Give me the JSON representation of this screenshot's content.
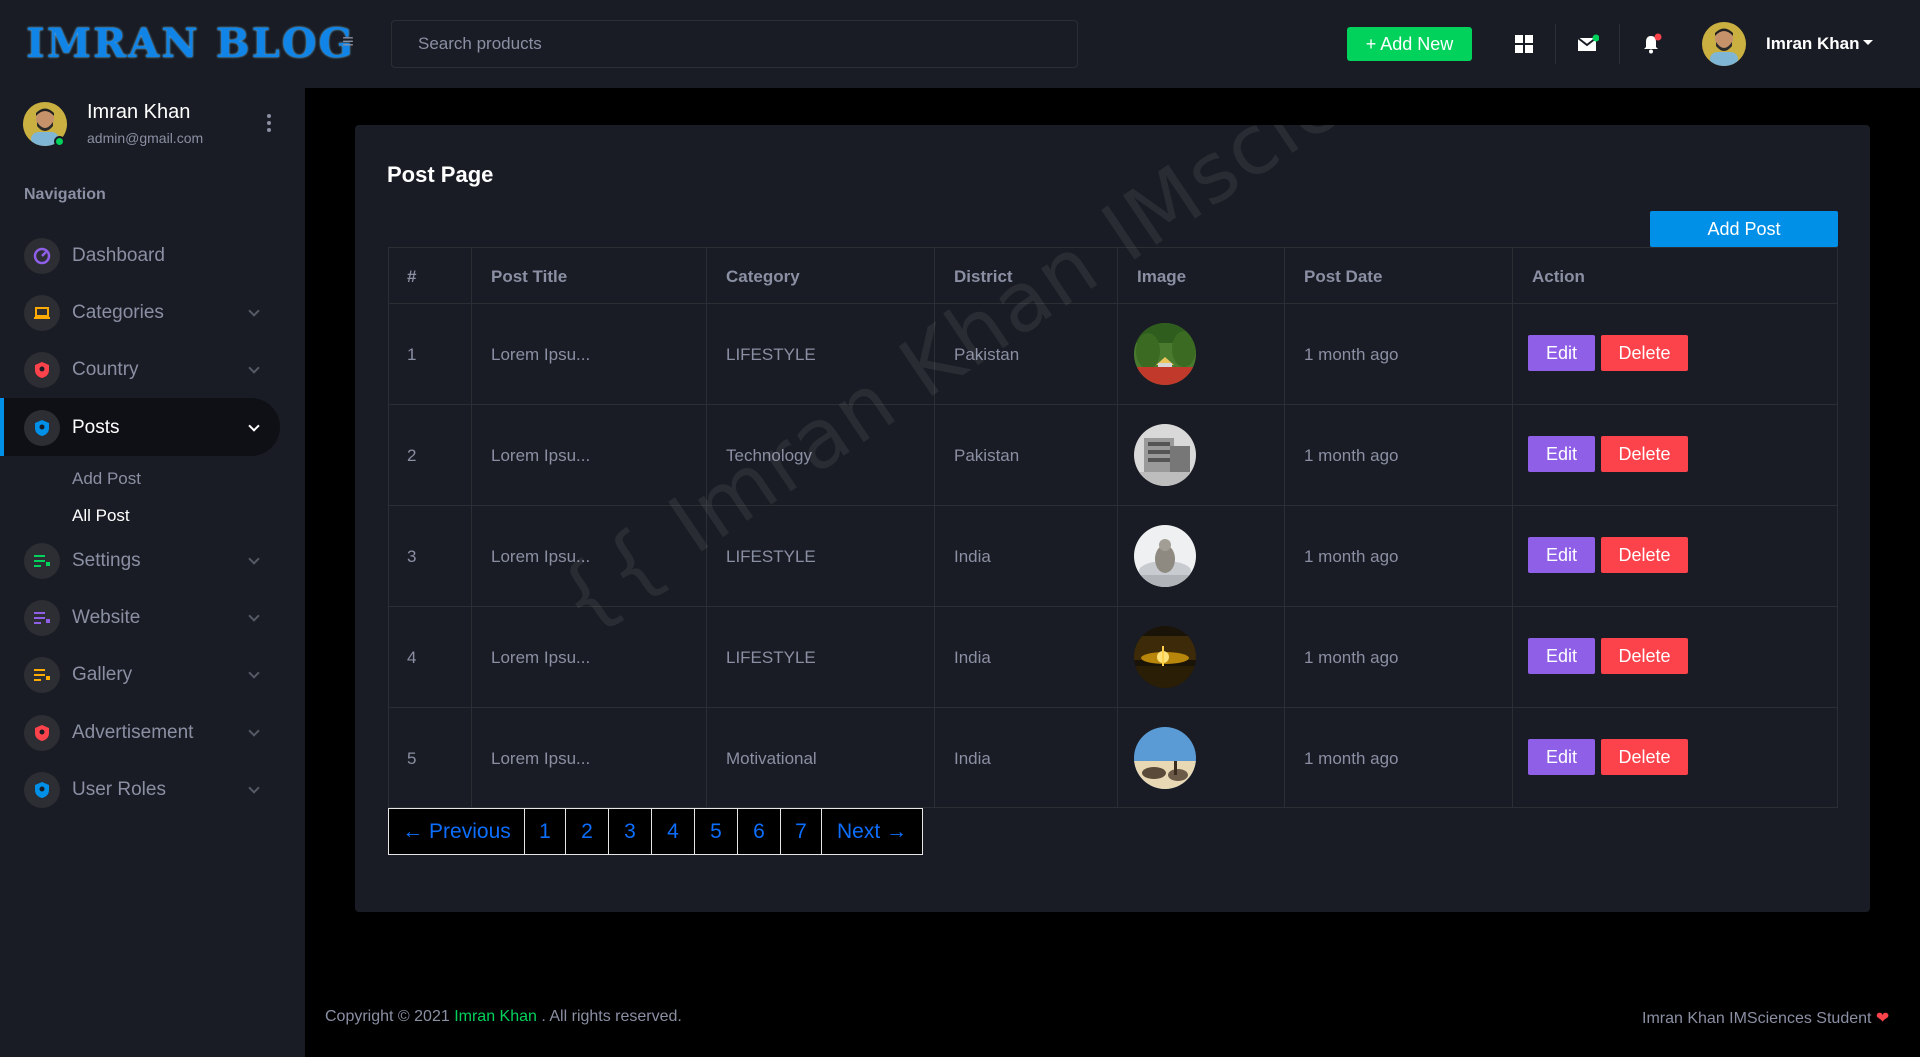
{
  "brand": "IMRAN BLOG",
  "search": {
    "placeholder": "Search products"
  },
  "header": {
    "add_new_label": "+ Add New",
    "user_name": "Imran Khan"
  },
  "sidebar": {
    "profile": {
      "name": "Imran Khan",
      "email": "admin@gmail.com"
    },
    "heading": "Navigation",
    "items": [
      {
        "label": "Dashboard",
        "icon": "speedometer-icon",
        "color": "#8f5fe8"
      },
      {
        "label": "Categories",
        "icon": "laptop-icon",
        "color": "#ffab00"
      },
      {
        "label": "Country",
        "icon": "shield-icon",
        "color": "#fc424a"
      },
      {
        "label": "Posts",
        "icon": "shield-icon",
        "color": "#0090e7",
        "active": true
      },
      {
        "label": "Settings",
        "icon": "playlist-icon",
        "color": "#00d25b"
      },
      {
        "label": "Website",
        "icon": "playlist-icon",
        "color": "#8f5fe8"
      },
      {
        "label": "Gallery",
        "icon": "playlist-icon",
        "color": "#ffab00"
      },
      {
        "label": "Advertisement",
        "icon": "shield-icon",
        "color": "#fc424a"
      },
      {
        "label": "User Roles",
        "icon": "shield-icon",
        "color": "#0090e7"
      }
    ],
    "posts_sub": [
      "Add Post",
      "All Post"
    ]
  },
  "page": {
    "title": "Post Page",
    "add_post_label": "Add Post",
    "watermark": "{{ Imran Khan IMsciences }}"
  },
  "table": {
    "headers": [
      "#",
      "Post Title",
      "Category",
      "District",
      "Image",
      "Post Date",
      "Action"
    ],
    "rows": [
      {
        "num": "1",
        "title": "Lorem Ipsu...",
        "category": "LIFESTYLE",
        "district": "Pakistan",
        "image": "garden-photo",
        "date": "1 month ago"
      },
      {
        "num": "2",
        "title": "Lorem Ipsu...",
        "category": "Technology",
        "district": "Pakistan",
        "image": "building-photo",
        "date": "1 month ago"
      },
      {
        "num": "3",
        "title": "Lorem Ipsu...",
        "category": "LIFESTYLE",
        "district": "India",
        "image": "statue-photo",
        "date": "1 month ago"
      },
      {
        "num": "4",
        "title": "Lorem Ipsu...",
        "category": "LIFESTYLE",
        "district": "India",
        "image": "sunset-photo",
        "date": "1 month ago"
      },
      {
        "num": "5",
        "title": "Lorem Ipsu...",
        "category": "Motivational",
        "district": "India",
        "image": "sky-photo",
        "date": "1 month ago"
      }
    ],
    "edit_label": "Edit",
    "delete_label": "Delete"
  },
  "pagination": {
    "previous": "← Previous",
    "pages": [
      "1",
      "2",
      "3",
      "4",
      "5",
      "6",
      "7"
    ],
    "next": "Next →"
  },
  "footer": {
    "copyright_prefix": "Copyright © 2021",
    "copyright_name": "Imran Khan",
    "copyright_suffix": ". All rights reserved.",
    "credit": "Imran Khan IMSciences Student"
  }
}
